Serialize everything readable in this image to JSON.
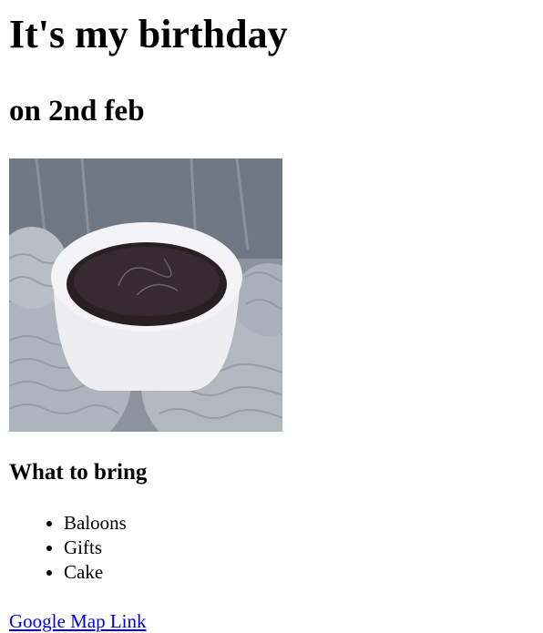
{
  "heading": "It's my birthday",
  "subheading": "on 2nd feb",
  "image": {
    "alt": "Cup of coffee held in knitted mittens"
  },
  "bring": {
    "title": "What to bring",
    "items": [
      "Baloons",
      "Gifts",
      "Cake"
    ]
  },
  "link": {
    "label": "Google Map Link"
  },
  "colors": {
    "link": "#0000ee",
    "text": "#000000"
  }
}
